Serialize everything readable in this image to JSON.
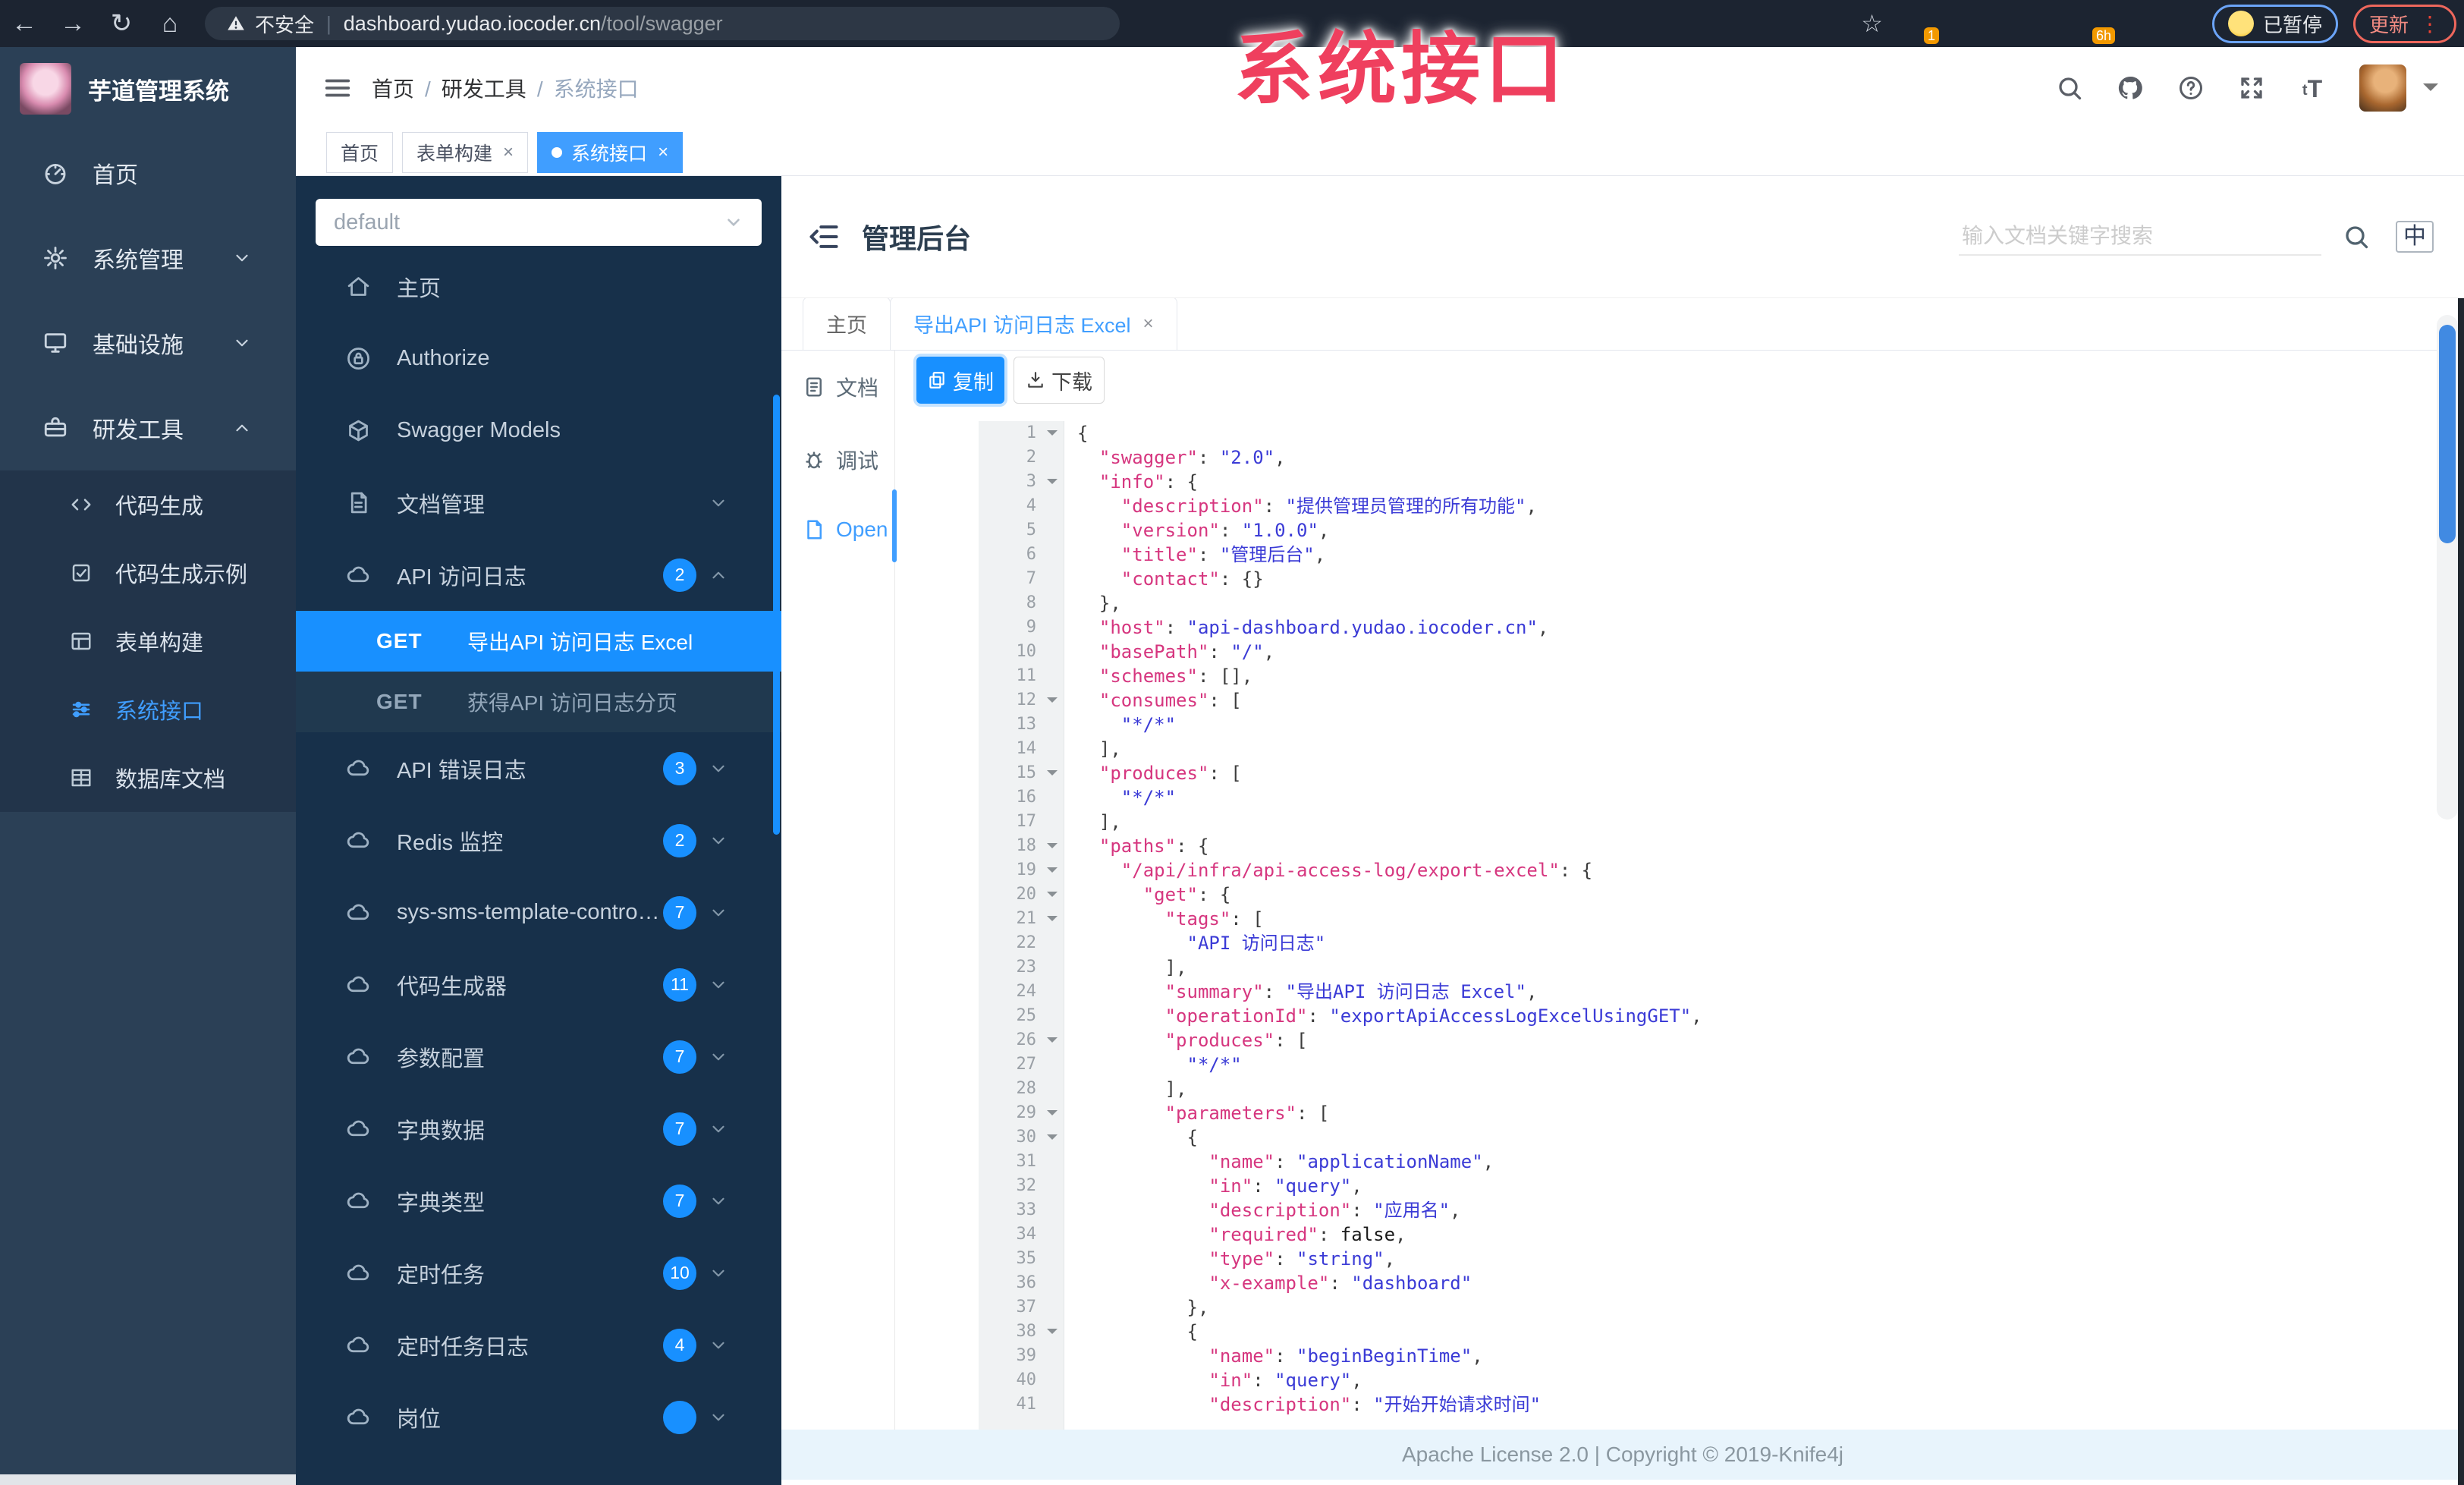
{
  "browser": {
    "security_label": "不安全",
    "url_host": "dashboard.yudao.iocoder.cn",
    "url_path": "/tool/swagger",
    "bookmark_icon": "star-icon",
    "extensions": [
      {
        "name": "extension-orange",
        "badge": "1"
      },
      {
        "name": "extension-drop",
        "badge": ""
      },
      {
        "name": "extension-green-ring",
        "badge": ""
      },
      {
        "name": "extension-grid",
        "badge": ""
      },
      {
        "name": "extension-dark",
        "badge": "6h"
      },
      {
        "name": "extension-leaf",
        "badge": ""
      },
      {
        "name": "extension-star",
        "badge": ""
      }
    ],
    "paused_label": "已暂停",
    "update_label": "更新"
  },
  "annotation": {
    "text": "系统接口",
    "color": "#ef3f5e"
  },
  "app": {
    "title": "芋道管理系统"
  },
  "sidebar": {
    "items": [
      {
        "label": "首页",
        "icon": "dashboard-icon",
        "chevron": ""
      },
      {
        "label": "系统管理",
        "icon": "gear-icon",
        "chevron": "down"
      },
      {
        "label": "基础设施",
        "icon": "monitor-icon",
        "chevron": "down"
      },
      {
        "label": "研发工具",
        "icon": "toolbox-icon",
        "chevron": "up"
      }
    ],
    "subitems": [
      {
        "label": "代码生成",
        "icon": "code-icon",
        "active": false
      },
      {
        "label": "代码生成示例",
        "icon": "code-example-icon",
        "active": false
      },
      {
        "label": "表单构建",
        "icon": "form-build-icon",
        "active": false
      },
      {
        "label": "系统接口",
        "icon": "api-sliders-icon",
        "active": true
      },
      {
        "label": "数据库文档",
        "icon": "database-doc-icon",
        "active": false
      }
    ]
  },
  "header": {
    "breadcrumb": [
      "首页",
      "研发工具",
      "系统接口"
    ]
  },
  "tags_view": [
    {
      "label": "首页",
      "closable": false,
      "active": false
    },
    {
      "label": "表单构建",
      "closable": true,
      "active": false
    },
    {
      "label": "系统接口",
      "closable": true,
      "active": true
    }
  ],
  "api_panel": {
    "group_select_value": "default",
    "nav": [
      {
        "label": "主页",
        "icon": "home-icon",
        "chevron": ""
      },
      {
        "label": "Authorize",
        "icon": "lock-icon",
        "chevron": ""
      },
      {
        "label": "Swagger Models",
        "icon": "cube-icon",
        "chevron": ""
      },
      {
        "label": "文档管理",
        "icon": "doc-icon",
        "chevron": "down"
      }
    ],
    "groups": [
      {
        "label": "API 访问日志",
        "count": "2",
        "chevron": "up",
        "expanded": true,
        "children": [
          {
            "method": "GET",
            "label": "导出API 访问日志 Excel",
            "active": true
          },
          {
            "method": "GET",
            "label": "获得API 访问日志分页",
            "active": false
          }
        ]
      },
      {
        "label": "API 错误日志",
        "count": "3",
        "chevron": "down"
      },
      {
        "label": "Redis 监控",
        "count": "2",
        "chevron": "down"
      },
      {
        "label": "sys-sms-template-controller",
        "count": "7",
        "chevron": "down"
      },
      {
        "label": "代码生成器",
        "count": "11",
        "chevron": "down"
      },
      {
        "label": "参数配置",
        "count": "7",
        "chevron": "down"
      },
      {
        "label": "字典数据",
        "count": "7",
        "chevron": "down"
      },
      {
        "label": "字典类型",
        "count": "7",
        "chevron": "down"
      },
      {
        "label": "定时任务",
        "count": "10",
        "chevron": "down"
      },
      {
        "label": "定时任务日志",
        "count": "4",
        "chevron": "down"
      },
      {
        "label": "岗位",
        "count": "",
        "chevron": "down"
      }
    ]
  },
  "content": {
    "title": "管理后台",
    "search_placeholder": "输入文档关键字搜索",
    "lang_label": "中",
    "doc_tabs": [
      {
        "label": "主页",
        "closable": false,
        "active": false
      },
      {
        "label": "导出API 访问日志 Excel",
        "closable": true,
        "active": true
      }
    ],
    "side_tabs": [
      {
        "label": "文档",
        "icon": "doc-tab-icon",
        "active": false
      },
      {
        "label": "调试",
        "icon": "debug-icon",
        "active": false
      },
      {
        "label": "Open",
        "icon": "open-file-icon",
        "active": true
      }
    ],
    "copy_label": "复制",
    "download_label": "下载"
  },
  "code": {
    "lines": [
      {
        "n": 1,
        "f": true,
        "t": [
          [
            "p",
            "{"
          ]
        ]
      },
      {
        "n": 2,
        "t": [
          [
            "p",
            "  "
          ],
          [
            "k",
            "\"swagger\""
          ],
          [
            "p",
            ": "
          ],
          [
            "s",
            "\"2.0\""
          ],
          [
            "p",
            ","
          ]
        ]
      },
      {
        "n": 3,
        "f": true,
        "t": [
          [
            "p",
            "  "
          ],
          [
            "k",
            "\"info\""
          ],
          [
            "p",
            ": {"
          ]
        ]
      },
      {
        "n": 4,
        "t": [
          [
            "p",
            "    "
          ],
          [
            "k",
            "\"description\""
          ],
          [
            "p",
            ": "
          ],
          [
            "s",
            "\"提供管理员管理的所有功能\""
          ],
          [
            "p",
            ","
          ]
        ]
      },
      {
        "n": 5,
        "t": [
          [
            "p",
            "    "
          ],
          [
            "k",
            "\"version\""
          ],
          [
            "p",
            ": "
          ],
          [
            "s",
            "\"1.0.0\""
          ],
          [
            "p",
            ","
          ]
        ]
      },
      {
        "n": 6,
        "t": [
          [
            "p",
            "    "
          ],
          [
            "k",
            "\"title\""
          ],
          [
            "p",
            ": "
          ],
          [
            "s",
            "\"管理后台\""
          ],
          [
            "p",
            ","
          ]
        ]
      },
      {
        "n": 7,
        "t": [
          [
            "p",
            "    "
          ],
          [
            "k",
            "\"contact\""
          ],
          [
            "p",
            ": {}"
          ]
        ]
      },
      {
        "n": 8,
        "t": [
          [
            "p",
            "  },"
          ]
        ]
      },
      {
        "n": 9,
        "t": [
          [
            "p",
            "  "
          ],
          [
            "k",
            "\"host\""
          ],
          [
            "p",
            ": "
          ],
          [
            "s",
            "\"api-dashboard.yudao.iocoder.cn\""
          ],
          [
            "p",
            ","
          ]
        ]
      },
      {
        "n": 10,
        "t": [
          [
            "p",
            "  "
          ],
          [
            "k",
            "\"basePath\""
          ],
          [
            "p",
            ": "
          ],
          [
            "s",
            "\"/\""
          ],
          [
            "p",
            ","
          ]
        ]
      },
      {
        "n": 11,
        "t": [
          [
            "p",
            "  "
          ],
          [
            "k",
            "\"schemes\""
          ],
          [
            "p",
            ": [],"
          ]
        ]
      },
      {
        "n": 12,
        "f": true,
        "t": [
          [
            "p",
            "  "
          ],
          [
            "k",
            "\"consumes\""
          ],
          [
            "p",
            ": ["
          ]
        ]
      },
      {
        "n": 13,
        "t": [
          [
            "p",
            "    "
          ],
          [
            "s",
            "\"*/*\""
          ]
        ]
      },
      {
        "n": 14,
        "t": [
          [
            "p",
            "  ],"
          ]
        ]
      },
      {
        "n": 15,
        "f": true,
        "t": [
          [
            "p",
            "  "
          ],
          [
            "k",
            "\"produces\""
          ],
          [
            "p",
            ": ["
          ]
        ]
      },
      {
        "n": 16,
        "t": [
          [
            "p",
            "    "
          ],
          [
            "s",
            "\"*/*\""
          ]
        ]
      },
      {
        "n": 17,
        "t": [
          [
            "p",
            "  ],"
          ]
        ]
      },
      {
        "n": 18,
        "f": true,
        "t": [
          [
            "p",
            "  "
          ],
          [
            "k",
            "\"paths\""
          ],
          [
            "p",
            ": {"
          ]
        ]
      },
      {
        "n": 19,
        "f": true,
        "t": [
          [
            "p",
            "    "
          ],
          [
            "k",
            "\"/api/infra/api-access-log/export-excel\""
          ],
          [
            "p",
            ": {"
          ]
        ]
      },
      {
        "n": 20,
        "f": true,
        "t": [
          [
            "p",
            "      "
          ],
          [
            "k",
            "\"get\""
          ],
          [
            "p",
            ": {"
          ]
        ]
      },
      {
        "n": 21,
        "f": true,
        "t": [
          [
            "p",
            "        "
          ],
          [
            "k",
            "\"tags\""
          ],
          [
            "p",
            ": ["
          ]
        ]
      },
      {
        "n": 22,
        "t": [
          [
            "p",
            "          "
          ],
          [
            "s",
            "\"API 访问日志\""
          ]
        ]
      },
      {
        "n": 23,
        "t": [
          [
            "p",
            "        ],"
          ]
        ]
      },
      {
        "n": 24,
        "t": [
          [
            "p",
            "        "
          ],
          [
            "k",
            "\"summary\""
          ],
          [
            "p",
            ": "
          ],
          [
            "s",
            "\"导出API 访问日志 Excel\""
          ],
          [
            "p",
            ","
          ]
        ]
      },
      {
        "n": 25,
        "t": [
          [
            "p",
            "        "
          ],
          [
            "k",
            "\"operationId\""
          ],
          [
            "p",
            ": "
          ],
          [
            "s",
            "\"exportApiAccessLogExcelUsingGET\""
          ],
          [
            "p",
            ","
          ]
        ]
      },
      {
        "n": 26,
        "f": true,
        "t": [
          [
            "p",
            "        "
          ],
          [
            "k",
            "\"produces\""
          ],
          [
            "p",
            ": ["
          ]
        ]
      },
      {
        "n": 27,
        "t": [
          [
            "p",
            "          "
          ],
          [
            "s",
            "\"*/*\""
          ]
        ]
      },
      {
        "n": 28,
        "t": [
          [
            "p",
            "        ],"
          ]
        ]
      },
      {
        "n": 29,
        "f": true,
        "t": [
          [
            "p",
            "        "
          ],
          [
            "k",
            "\"parameters\""
          ],
          [
            "p",
            ": ["
          ]
        ]
      },
      {
        "n": 30,
        "f": true,
        "t": [
          [
            "p",
            "          {"
          ]
        ]
      },
      {
        "n": 31,
        "t": [
          [
            "p",
            "            "
          ],
          [
            "k",
            "\"name\""
          ],
          [
            "p",
            ": "
          ],
          [
            "s",
            "\"applicationName\""
          ],
          [
            "p",
            ","
          ]
        ]
      },
      {
        "n": 32,
        "t": [
          [
            "p",
            "            "
          ],
          [
            "k",
            "\"in\""
          ],
          [
            "p",
            ": "
          ],
          [
            "s",
            "\"query\""
          ],
          [
            "p",
            ","
          ]
        ]
      },
      {
        "n": 33,
        "t": [
          [
            "p",
            "            "
          ],
          [
            "k",
            "\"description\""
          ],
          [
            "p",
            ": "
          ],
          [
            "s",
            "\"应用名\""
          ],
          [
            "p",
            ","
          ]
        ]
      },
      {
        "n": 34,
        "t": [
          [
            "p",
            "            "
          ],
          [
            "k",
            "\"required\""
          ],
          [
            "p",
            ": "
          ],
          [
            "b",
            "false"
          ],
          [
            "p",
            ","
          ]
        ]
      },
      {
        "n": 35,
        "t": [
          [
            "p",
            "            "
          ],
          [
            "k",
            "\"type\""
          ],
          [
            "p",
            ": "
          ],
          [
            "s",
            "\"string\""
          ],
          [
            "p",
            ","
          ]
        ]
      },
      {
        "n": 36,
        "t": [
          [
            "p",
            "            "
          ],
          [
            "k",
            "\"x-example\""
          ],
          [
            "p",
            ": "
          ],
          [
            "s",
            "\"dashboard\""
          ]
        ]
      },
      {
        "n": 37,
        "t": [
          [
            "p",
            "          },"
          ]
        ]
      },
      {
        "n": 38,
        "f": true,
        "t": [
          [
            "p",
            "          {"
          ]
        ]
      },
      {
        "n": 39,
        "t": [
          [
            "p",
            "            "
          ],
          [
            "k",
            "\"name\""
          ],
          [
            "p",
            ": "
          ],
          [
            "s",
            "\"beginBeginTime\""
          ],
          [
            "p",
            ","
          ]
        ]
      },
      {
        "n": 40,
        "t": [
          [
            "p",
            "            "
          ],
          [
            "k",
            "\"in\""
          ],
          [
            "p",
            ": "
          ],
          [
            "s",
            "\"query\""
          ],
          [
            "p",
            ","
          ]
        ]
      },
      {
        "n": 41,
        "t": [
          [
            "p",
            "            "
          ],
          [
            "k",
            "\"description\""
          ],
          [
            "p",
            ": "
          ],
          [
            "s",
            "\"开始开始请求时间\""
          ]
        ]
      }
    ]
  },
  "footer": {
    "text": "Apache License 2.0 | Copyright © 2019-Knife4j"
  }
}
